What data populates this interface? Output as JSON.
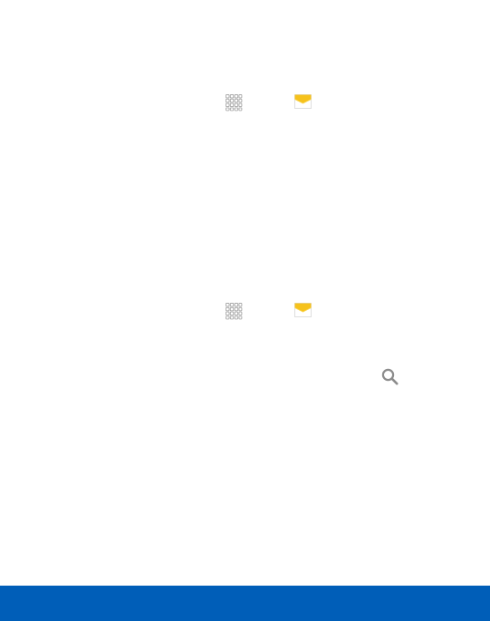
{
  "colors": {
    "footer_bar": "#005eb8",
    "mail_envelope": "#f6c21c",
    "mail_envelope_fold": "#f9d656",
    "apps_grid": "#a8a8a8",
    "search_glass": "#8c8c8c"
  },
  "icons": {
    "row1": [
      "apps-icon",
      "mail-icon"
    ],
    "row2": [
      "apps-icon",
      "mail-icon"
    ],
    "standalone": [
      "search-icon"
    ]
  }
}
